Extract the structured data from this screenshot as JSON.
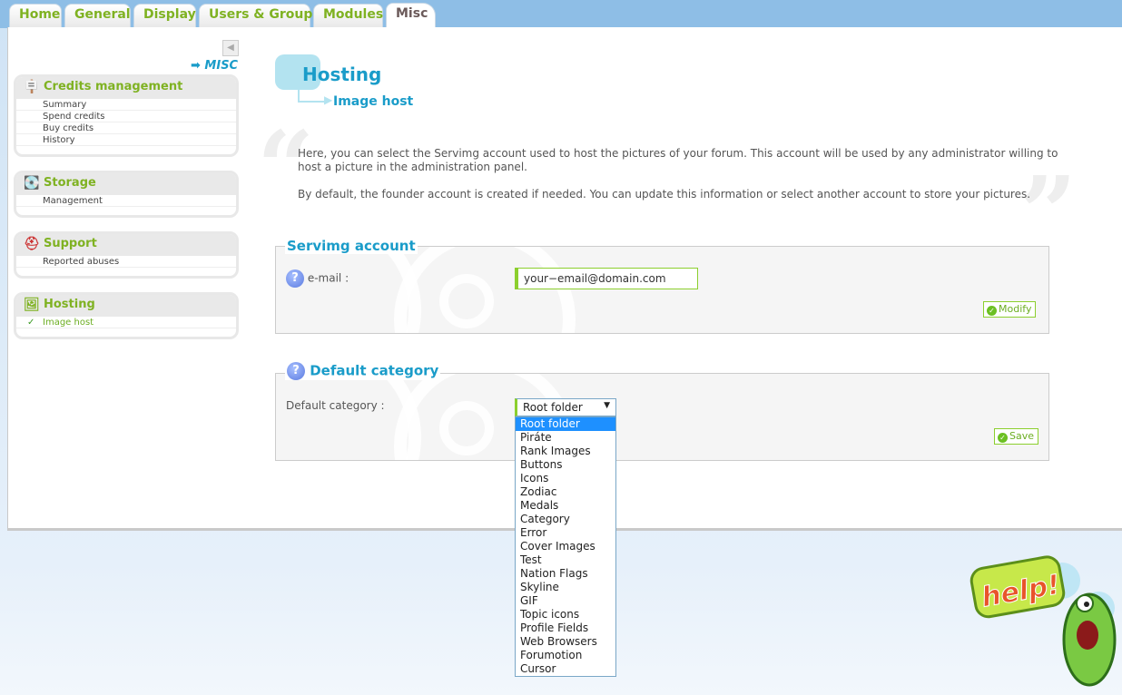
{
  "tabs": [
    {
      "label": "Home"
    },
    {
      "label": "General"
    },
    {
      "label": "Display"
    },
    {
      "label": "Users & Groups"
    },
    {
      "label": "Modules"
    },
    {
      "label": "Misc",
      "active": true
    }
  ],
  "sidebar": {
    "section_label": "MISC",
    "boxes": [
      {
        "title": "Credits management",
        "icon": "sign-icon",
        "items": [
          "Summary",
          "Spend credits",
          "Buy credits",
          "History"
        ]
      },
      {
        "title": "Storage",
        "icon": "hard-drive-icon",
        "items": [
          "Management"
        ]
      },
      {
        "title": "Support",
        "icon": "lifebuoy-icon",
        "items": [
          "Reported abuses"
        ]
      },
      {
        "title": "Hosting",
        "icon": "images-icon",
        "items": [
          "Image host"
        ],
        "selected": "Image host"
      }
    ]
  },
  "main": {
    "title": "Hosting",
    "subtitle": "Image host",
    "intro": [
      "Here, you can select the Servimg account used to host the pictures of your forum. This account will be used by any administrator willing to host a picture in the administration panel.",
      "By default, the founder account is created if needed. You can update this information or select another account to store your pictures."
    ],
    "serving_account": {
      "legend": "Servimg account",
      "email_label": "e-mail :",
      "email_value": "your−email@domain.com",
      "modify_label": "Modify"
    },
    "default_category": {
      "legend": "Default category",
      "label": "Default category :",
      "selected": "Root folder",
      "options": [
        "Root folder",
        "Piráte",
        "Rank Images",
        "Buttons",
        "Icons",
        "Zodiac",
        "Medals",
        "Category",
        "Error",
        "Cover Images",
        "Test",
        "Nation Flags",
        "Skyline",
        "GIF",
        "Topic icons",
        "Profile Fields",
        "Web Browsers",
        "Forumotion",
        "Cursor"
      ],
      "save_label": "Save"
    }
  },
  "help": {
    "label": "help!"
  },
  "colors": {
    "accent_green": "#7fb222",
    "accent_blue": "#1a9cc9",
    "highlight": "#1e90ff"
  }
}
